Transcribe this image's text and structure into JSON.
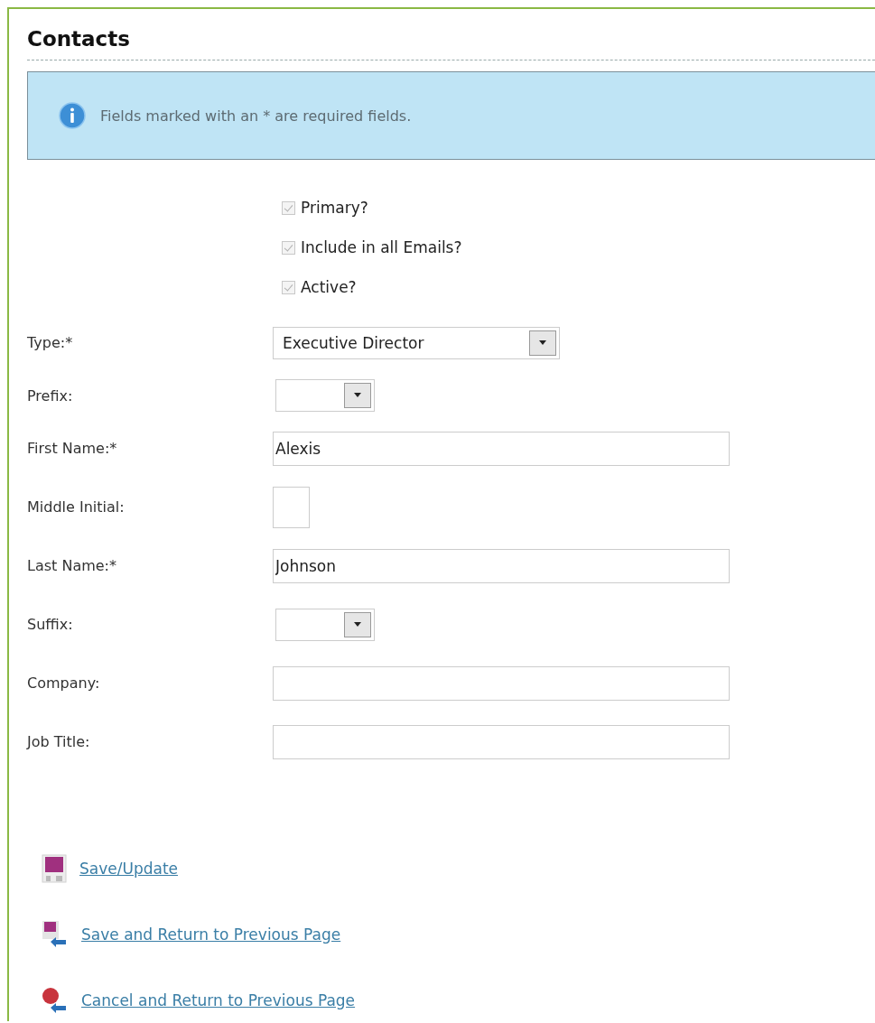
{
  "title": "Contacts",
  "notice": {
    "text": "Fields marked with an * are required fields."
  },
  "checkboxes": [
    {
      "label": "Primary?",
      "checked": true,
      "disabled": true
    },
    {
      "label": "Include in all Emails?",
      "checked": true,
      "disabled": true
    },
    {
      "label": "Active?",
      "checked": true,
      "disabled": true
    }
  ],
  "fields": [
    {
      "label": "Type:*",
      "kind": "select-wide",
      "value": "Executive Director"
    },
    {
      "label": "Prefix:",
      "kind": "select-narrow"
    },
    {
      "label": "First Name:*",
      "kind": "text",
      "value": "Alexis"
    },
    {
      "label": "Middle Initial:",
      "kind": "initial"
    },
    {
      "label": "Last Name:*",
      "kind": "text",
      "value": "Johnson"
    },
    {
      "label": "Suffix:",
      "kind": "select-narrow"
    },
    {
      "label": "Company:",
      "kind": "text"
    },
    {
      "label": "Job Title:",
      "kind": "text"
    }
  ],
  "actions": [
    {
      "label": "Save/Update",
      "kind": "save"
    },
    {
      "label": "Save and Return to Previous Page",
      "kind": "save-return"
    },
    {
      "label": "Cancel and Return to Previous Page",
      "kind": "cancel-return"
    }
  ]
}
